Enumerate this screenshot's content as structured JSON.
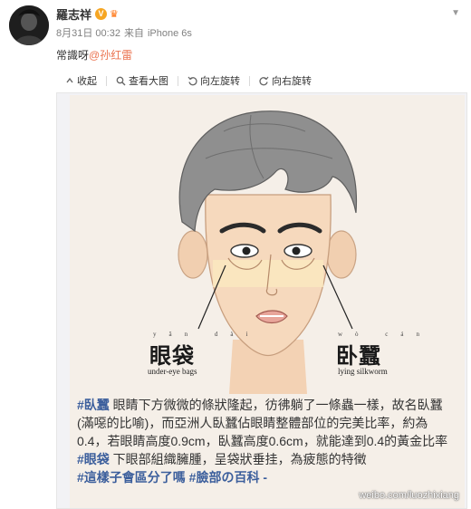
{
  "post": {
    "author": "羅志祥",
    "verified_badge": "V",
    "timestamp": "8月31日 00:32",
    "source_prefix": "来自",
    "source": "iPhone 6s",
    "text": "常識呀",
    "mention": "@孙红雷"
  },
  "toolbar": {
    "collapse": "收起",
    "view_large": "查看大图",
    "rotate_left": "向左旋转",
    "rotate_right": "向右旋转"
  },
  "image": {
    "label_left": {
      "pinyin": "yǎn dài",
      "chinese": "眼袋",
      "english": "under-eye bags"
    },
    "label_right": {
      "pinyin": "wò cán",
      "chinese": "卧蠶",
      "english": "lying silkworm"
    },
    "caption": {
      "p1_tag": "#臥蠶",
      "p1_text": " 眼睛下方微微的條狀隆起，彷彿躺了一條蟲一樣，故名臥蠶(滿噁的比喻)，而亞洲人臥蠶佔眼睛整體部位的完美比率，約為0.4，若眼睛高度0.9cm，臥蠶高度0.6cm，就能達到0.4的黃金比率",
      "p2_tag": "#眼袋",
      "p2_text": " 下眼部組織臃腫，呈袋狀垂挂，為疲態的特徵",
      "p3_tag1": "#這樣子會區分了嗎",
      "p3_tag2": " #臉部の百科 -"
    },
    "watermark": "weibo.com/luozhixiang",
    "colors": {
      "skin": "#f6d9bd",
      "hair": "#8a8a8a",
      "background": "#f5efe8",
      "hashtag": "#3b5e9c",
      "mention": "#eb7350"
    }
  }
}
